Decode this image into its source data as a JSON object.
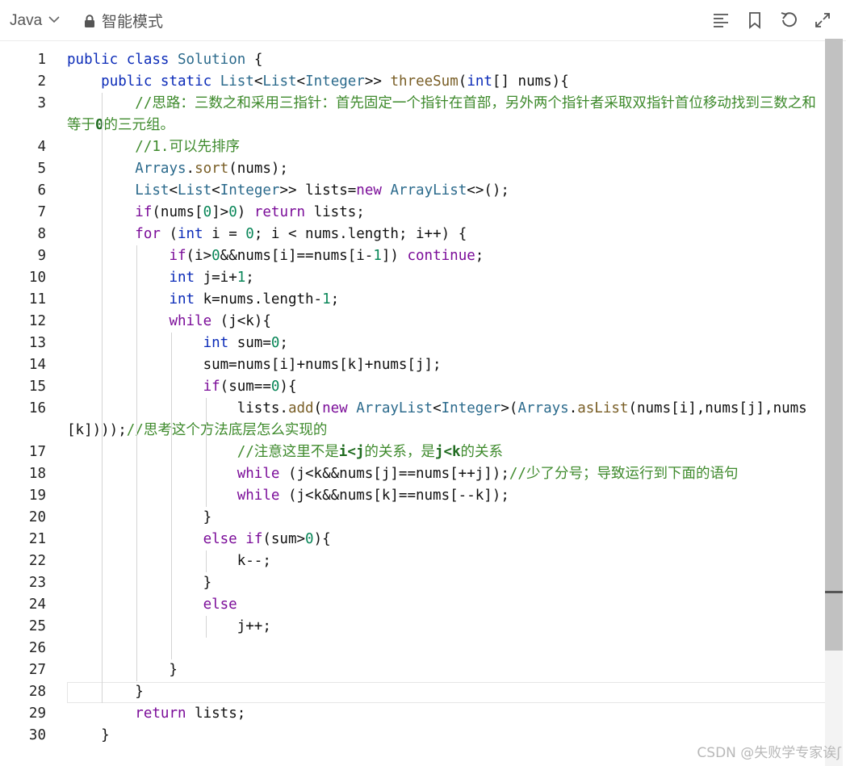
{
  "toolbar": {
    "language": "Java",
    "mode_label": "智能模式",
    "icons": [
      "format-icon",
      "bookmark-icon",
      "undo-icon",
      "expand-icon"
    ]
  },
  "editor": {
    "current_line": 28,
    "lines": [
      {
        "n": "1",
        "html": "<span class=\"kw2\">public</span> <span class=\"kw2\">class</span> <span class=\"ty\">Solution</span> {"
      },
      {
        "n": "2",
        "html": "    <span class=\"kw2\">public</span> <span class=\"kw2\">static</span> <span class=\"ty\">List</span>&lt;<span class=\"ty\">List</span>&lt;<span class=\"ty\">Integer</span>&gt;&gt; <span class=\"fn\">threeSum</span>(<span class=\"kw2\">int</span>[] nums){"
      },
      {
        "n": "3",
        "wrap": true,
        "html": "        <span class=\"cm\">//思路：三数之和采用三指针：首先固定一个指针在首部，另外两个指针者采取双指针首位移动找到三数之和等于<b class=\"cmb\">0</b>的三元组。</span>"
      },
      {
        "n": "4",
        "html": "        <span class=\"cm\">//1.可以先排序</span>"
      },
      {
        "n": "5",
        "html": "        <span class=\"ty\">Arrays</span>.<span class=\"fn\">sort</span>(nums);"
      },
      {
        "n": "6",
        "html": "        <span class=\"ty\">List</span>&lt;<span class=\"ty\">List</span>&lt;<span class=\"ty\">Integer</span>&gt;&gt; lists=<span class=\"kw\">new</span> <span class=\"ty\">ArrayList</span>&lt;&gt;();"
      },
      {
        "n": "7",
        "html": "        <span class=\"kw\">if</span>(nums[<span class=\"nm\">0</span>]&gt;<span class=\"nm\">0</span>) <span class=\"kw\">return</span> lists;"
      },
      {
        "n": "8",
        "html": "        <span class=\"kw\">for</span> (<span class=\"kw2\">int</span> i = <span class=\"nm\">0</span>; i &lt; nums.length; i++) {"
      },
      {
        "n": "9",
        "html": "            <span class=\"kw\">if</span>(i&gt;<span class=\"nm\">0</span>&amp;&amp;nums[i]==nums[i-<span class=\"nm\">1</span>]) <span class=\"kw\">continue</span>;"
      },
      {
        "n": "10",
        "html": "            <span class=\"kw2\">int</span> j=i+<span class=\"nm\">1</span>;"
      },
      {
        "n": "11",
        "html": "            <span class=\"kw2\">int</span> k=nums.length-<span class=\"nm\">1</span>;"
      },
      {
        "n": "12",
        "html": "            <span class=\"kw\">while</span> (j&lt;k){"
      },
      {
        "n": "13",
        "html": "                <span class=\"kw2\">int</span> sum=<span class=\"nm\">0</span>;"
      },
      {
        "n": "14",
        "html": "                sum=nums[i]+nums[k]+nums[j];"
      },
      {
        "n": "15",
        "html": "                <span class=\"kw\">if</span>(sum==<span class=\"nm\">0</span>){"
      },
      {
        "n": "16",
        "wrap": true,
        "html": "                    lists.<span class=\"fn\">add</span>(<span class=\"kw\">new</span> <span class=\"ty\">ArrayList</span>&lt;<span class=\"ty\">Integer</span>&gt;(<span class=\"ty\">Arrays</span>.<span class=\"fn\">asList</span>(nums[i],nums[j],nums[k])));<span class=\"cm\">//思考这个方法底层怎么实现的</span>"
      },
      {
        "n": "17",
        "html": "                    <span class=\"cm\">//注意这里不是<b class=\"cmb\">i&lt;j</b>的关系，是<b class=\"cmb\">j&lt;k</b>的关系</span>"
      },
      {
        "n": "18",
        "html": "                    <span class=\"kw\">while</span> (j&lt;k&amp;&amp;nums[j]==nums[++j]);<span class=\"cm\">//少了分号；导致运行到下面的语句</span>"
      },
      {
        "n": "19",
        "html": "                    <span class=\"kw\">while</span> (j&lt;k&amp;&amp;nums[k]==nums[--k]);"
      },
      {
        "n": "20",
        "html": "                }"
      },
      {
        "n": "21",
        "html": "                <span class=\"kw\">else</span> <span class=\"kw\">if</span>(sum&gt;<span class=\"nm\">0</span>){"
      },
      {
        "n": "22",
        "html": "                    k--;"
      },
      {
        "n": "23",
        "html": "                }"
      },
      {
        "n": "24",
        "html": "                <span class=\"kw\">else</span>"
      },
      {
        "n": "25",
        "html": "                    j++;"
      },
      {
        "n": "26",
        "html": ""
      },
      {
        "n": "27",
        "html": "            }"
      },
      {
        "n": "28",
        "html": "        }"
      },
      {
        "n": "29",
        "html": "        <span class=\"kw\">return</span> lists;"
      },
      {
        "n": "30",
        "html": "    }"
      }
    ]
  },
  "watermark": "CSDN @失败学专家诶ʃ"
}
